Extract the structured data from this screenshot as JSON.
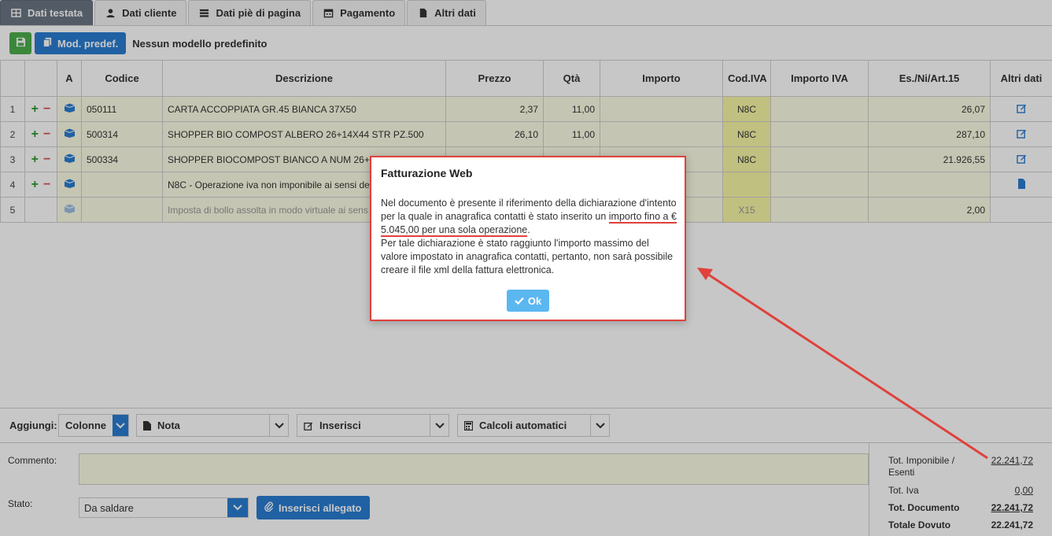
{
  "tabs": [
    {
      "label": "Dati testata",
      "icon": "table-icon",
      "active": true
    },
    {
      "label": "Dati cliente",
      "icon": "user-icon"
    },
    {
      "label": "Dati piè di pagina",
      "icon": "rows-icon"
    },
    {
      "label": "Pagamento",
      "icon": "calendar-icon"
    },
    {
      "label": "Altri dati",
      "icon": "file-icon"
    }
  ],
  "toolbar": {
    "template_button": "Mod. predef.",
    "template_status": "Nessun modello predefinito"
  },
  "grid": {
    "headers": [
      "",
      "",
      "A",
      "Codice",
      "Descrizione",
      "Prezzo",
      "Qtà",
      "Importo",
      "Cod.IVA",
      "Importo IVA",
      "Es./Ni/Art.15",
      "Altri dati"
    ],
    "rows": [
      {
        "num": "1",
        "code": "050111",
        "desc": "CARTA ACCOPPIATA GR.45 BIANCA 37X50",
        "price": "2,37",
        "qty": "11,00",
        "iva": "N8C",
        "es": "26,07"
      },
      {
        "num": "2",
        "code": "500314",
        "desc": "SHOPPER BIO COMPOST ALBERO 26+14X44 STR PZ.500",
        "price": "26,10",
        "qty": "11,00",
        "iva": "N8C",
        "es": "287,10"
      },
      {
        "num": "3",
        "code": "500334",
        "desc": "SHOPPER BIOCOMPOST BIANCO A NUM 26+14",
        "price": "",
        "qty": "",
        "iva": "N8C",
        "es": "21.926,55"
      },
      {
        "num": "4",
        "code": "",
        "desc": "N8C - Operazione iva non imponibile ai sensi de",
        "price": "",
        "qty": "",
        "iva": "",
        "es": ""
      },
      {
        "num": "5",
        "code": "",
        "desc": "Imposta di bollo assolta in modo virtuale ai sens",
        "price": "",
        "qty": "",
        "iva": "X15",
        "es": "2,00"
      }
    ]
  },
  "modal": {
    "title": "Fatturazione Web",
    "text_1": "Nel documento è presente il riferimento della dichiarazione d'intento per la quale in anagrafica contatti è stato inserito un ",
    "text_underlined": "importo fino a € 5.045,00 per una sola operazione",
    "text_2": ".",
    "text_3": "Per tale dichiarazione è stato raggiunto l'importo massimo del valore impostato in anagrafica contatti, pertanto, non sarà possibile creare il file xml della fattura elettronica.",
    "ok_label": "Ok"
  },
  "add_bar": {
    "label": "Aggiungi:",
    "columns": "Colonne",
    "note": "Nota",
    "insert": "Inserisci",
    "auto_calc": "Calcoli automatici"
  },
  "bottom": {
    "comment_label": "Commento:",
    "status_label": "Stato:",
    "status_value": "Da saldare",
    "attach_label": "Inserisci allegato"
  },
  "totals": {
    "imponibile_label": "Tot. Imponibile / Esenti",
    "imponibile_value": "22.241,72",
    "iva_label": "Tot. Iva",
    "iva_value": "0,00",
    "documento_label": "Tot. Documento",
    "documento_value": "22.241,72",
    "dovuto_label": "Totale Dovuto",
    "dovuto_value": "22.241,72"
  },
  "colors": {
    "accent": "#2a7dd1",
    "annotation": "#e0413c",
    "iva_cell": "#f7f7a6"
  }
}
